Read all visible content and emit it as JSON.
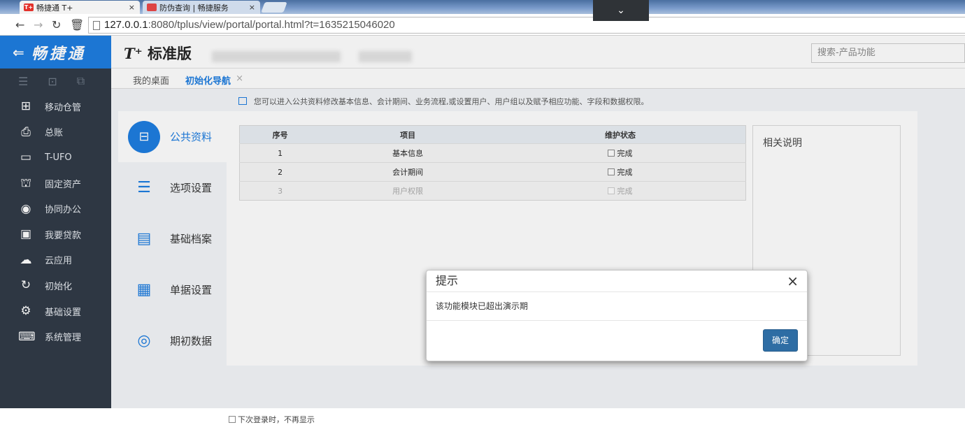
{
  "browser": {
    "tabs": [
      {
        "title": "畅捷通 T+",
        "favicon": "T+",
        "close": "×"
      },
      {
        "title": "防伪查询 | 畅捷服务",
        "close": "×"
      }
    ],
    "url_host": "127.0.0.1",
    "url_rest": ":8080/tplus/view/portal/portal.html?t=1635215046020",
    "chevron": "⌄"
  },
  "sidebar": {
    "logo": "畅捷通",
    "back_icon": "back-arrow-icon",
    "items": [
      {
        "label": "移动仓管",
        "icon": "warehouse-icon"
      },
      {
        "label": "总账",
        "icon": "ledger-icon"
      },
      {
        "label": "T-UFO",
        "icon": "ufo-report-icon"
      },
      {
        "label": "固定资产",
        "icon": "bank-building-icon"
      },
      {
        "label": "协同办公",
        "icon": "collaboration-icon"
      },
      {
        "label": "我要贷款",
        "icon": "money-icon"
      },
      {
        "label": "云应用",
        "icon": "cloud-icon"
      },
      {
        "label": "初始化",
        "icon": "refresh-icon"
      },
      {
        "label": "基础设置",
        "icon": "settings-icon"
      },
      {
        "label": "系统管理",
        "icon": "monitor-code-icon"
      }
    ]
  },
  "header": {
    "brand_t": "T⁺",
    "brand_text": "标准版",
    "search_placeholder": "搜索-产品功能"
  },
  "nav_tabs": [
    {
      "label": "我的桌面"
    },
    {
      "label": "初始化导航",
      "close": "×"
    }
  ],
  "tip": "您可以进入公共资料修改基本信息、会计期间、业务流程,或设置用户、用户组以及赋予相应功能、字段和数据权限。",
  "steps": [
    {
      "label": "公共资料",
      "active": true
    },
    {
      "label": "选项设置"
    },
    {
      "label": "基础档案"
    },
    {
      "label": "单据设置"
    },
    {
      "label": "期初数据"
    }
  ],
  "table": {
    "headers": [
      "序号",
      "项目",
      "维护状态"
    ],
    "rows": [
      {
        "no": "1",
        "item": "基本信息",
        "status": "完成"
      },
      {
        "no": "2",
        "item": "会计期间",
        "status": "完成"
      },
      {
        "no": "3",
        "item": "用户权限",
        "status": "完成"
      }
    ]
  },
  "related_title": "相关说明",
  "no_show_label": "下次登录时，不再显示",
  "dialog": {
    "title": "提示",
    "message": "该功能模块已超出演示期",
    "ok": "确定",
    "close": "×"
  }
}
